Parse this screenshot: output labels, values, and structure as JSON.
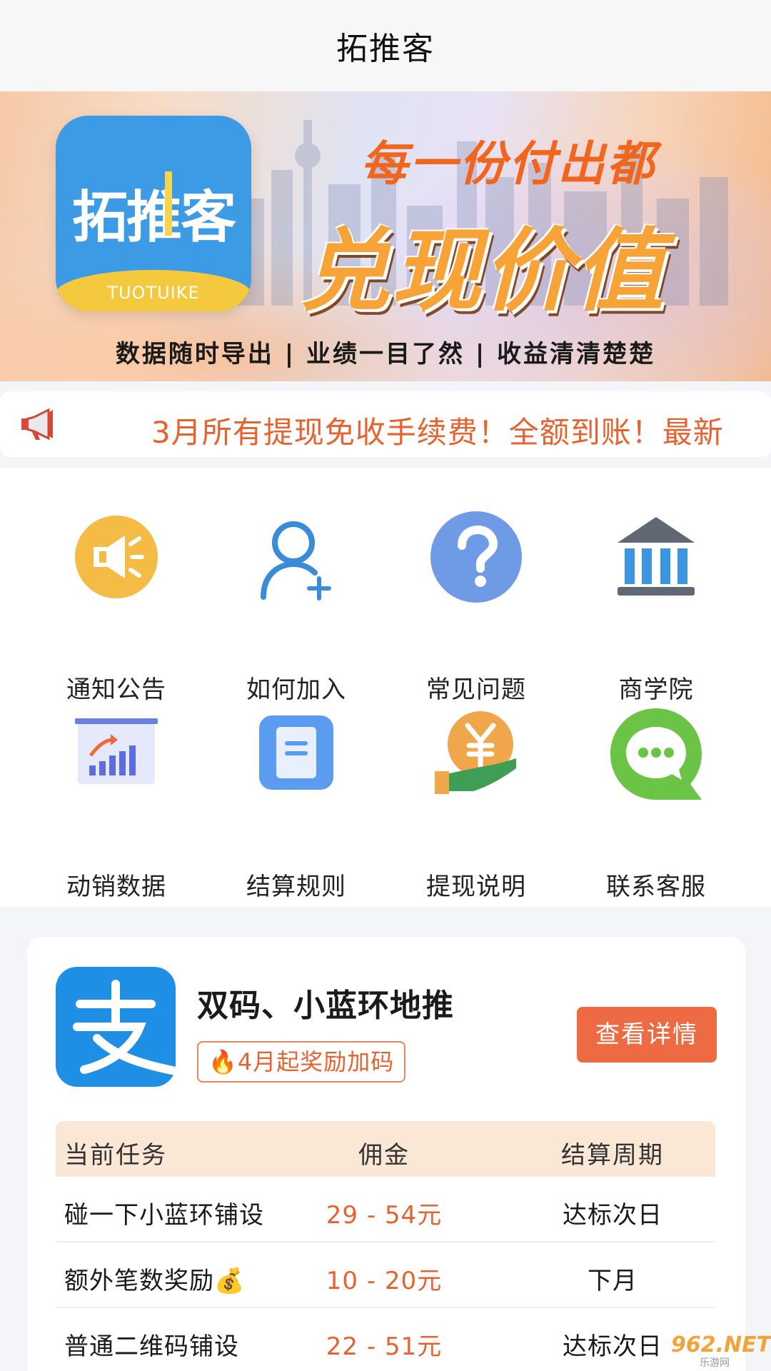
{
  "header": {
    "title": "拓推客"
  },
  "banner": {
    "logo_text": "拓推客",
    "logo_sub": "TUOTUIKE",
    "slogan_line1": "每一份付出都",
    "slogan_line2": "兑现价值",
    "subtitle": "数据随时导出 | 业绩一目了然 | 收益清清楚楚"
  },
  "notice": {
    "icon": "megaphone-icon",
    "text": "3月所有提现免收手续费！全额到账！最新"
  },
  "grid": {
    "items": [
      {
        "label": "通知公告",
        "icon": "speaker-icon"
      },
      {
        "label": "如何加入",
        "icon": "add-user-icon"
      },
      {
        "label": "常见问题",
        "icon": "question-icon"
      },
      {
        "label": "商学院",
        "icon": "academy-icon"
      },
      {
        "label": "动销数据",
        "icon": "sales-chart-icon"
      },
      {
        "label": "结算规则",
        "icon": "document-icon"
      },
      {
        "label": "提现说明",
        "icon": "yen-coin-hand-icon"
      },
      {
        "label": "联系客服",
        "icon": "chat-icon"
      }
    ]
  },
  "task_card": {
    "logo": "alipay-icon",
    "title": "双码、小蓝环地推",
    "tag": "🔥4月起奖励加码",
    "button": "查看详情",
    "table": {
      "headers": [
        "当前任务",
        "佣金",
        "结算周期"
      ],
      "rows": [
        {
          "task": "碰一下小蓝环铺设",
          "commission": "29 - 54元",
          "cycle": "达标次日"
        },
        {
          "task": "额外笔数奖励💰",
          "commission": "10 - 20元",
          "cycle": "下月"
        },
        {
          "task": "普通二维码铺设",
          "commission": "22 - 51元",
          "cycle": "达标次日"
        }
      ]
    }
  },
  "watermark": {
    "text": "962.NET",
    "sub": "乐游网"
  },
  "colors": {
    "accent": "#e8622f",
    "button": "#ee6a43",
    "alipay_blue": "#1f8fe6",
    "table_header_bg": "#fbe7d5"
  }
}
